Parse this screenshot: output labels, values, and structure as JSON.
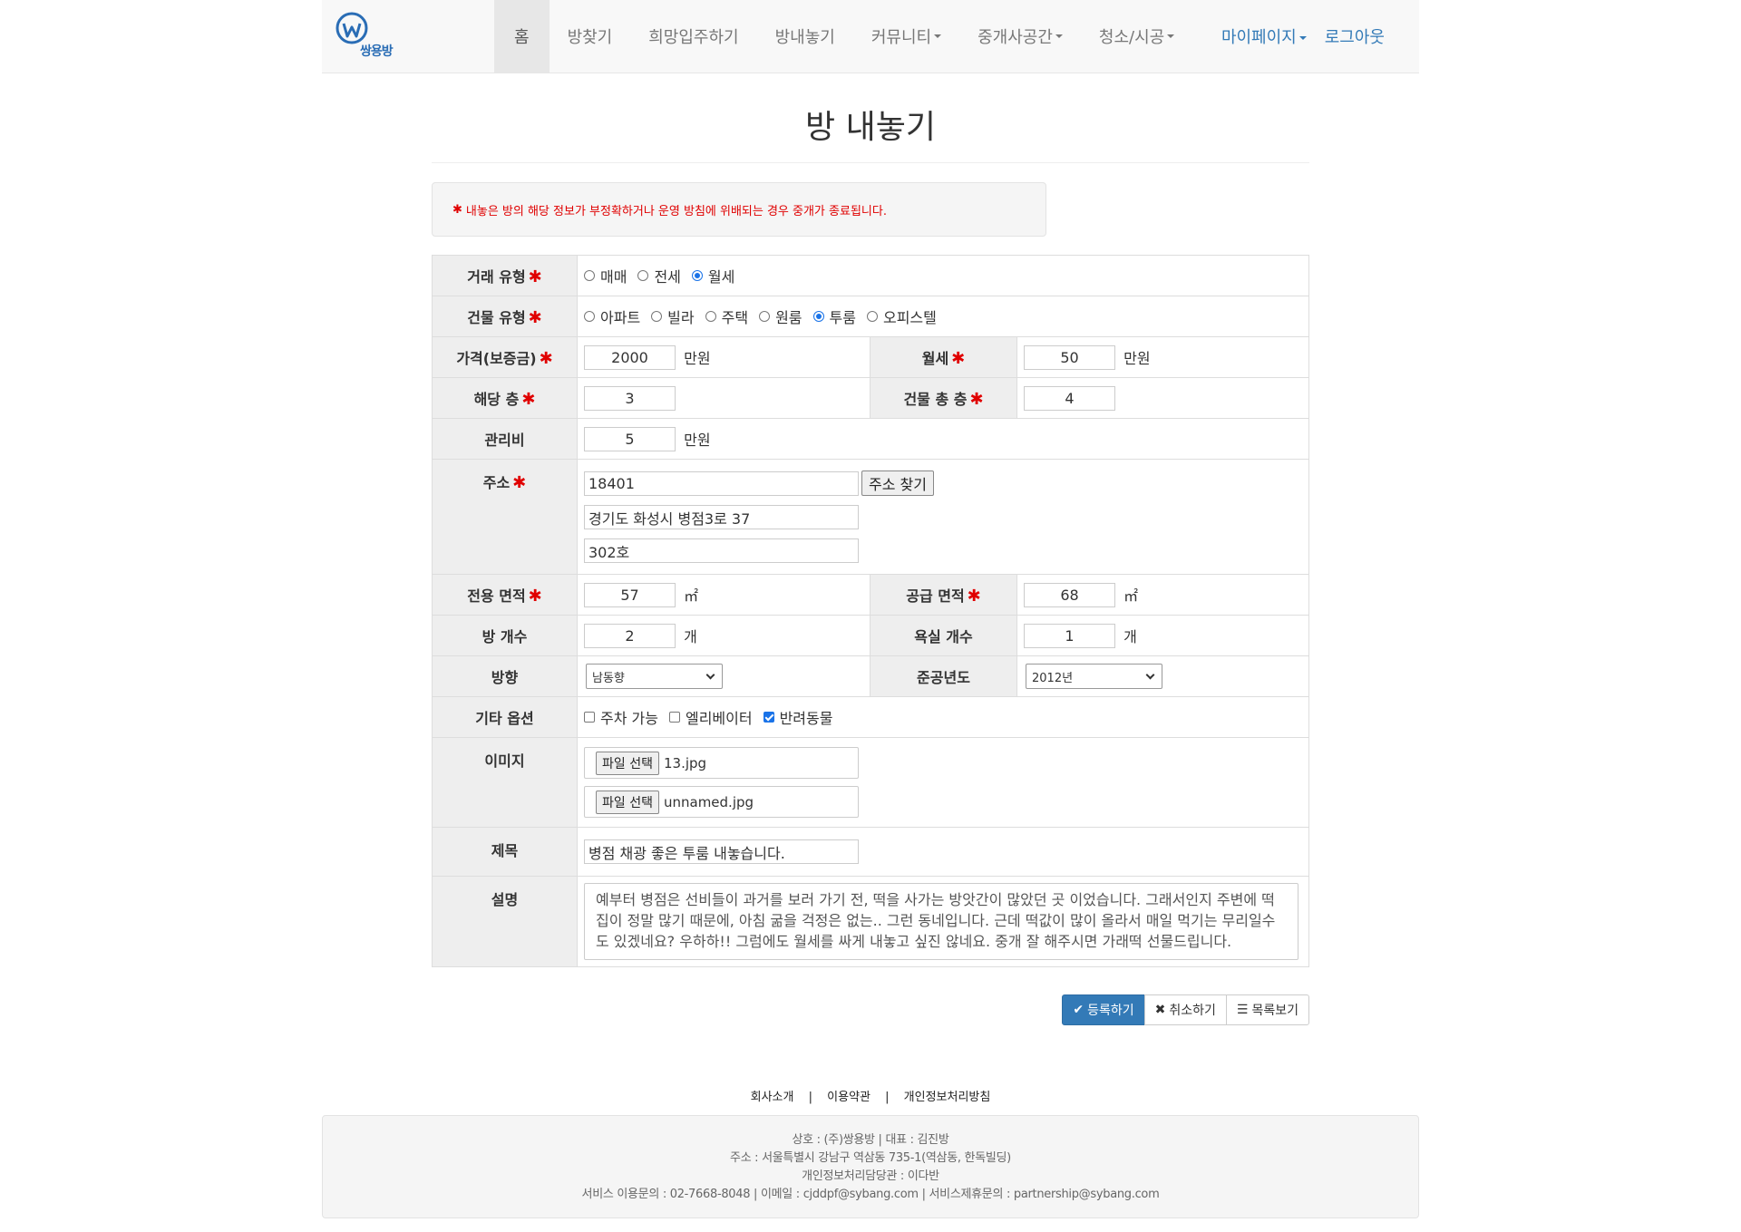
{
  "brand": {
    "name": "쌍용방"
  },
  "nav": {
    "items": [
      {
        "label": "홈"
      },
      {
        "label": "방찾기"
      },
      {
        "label": "희망입주하기"
      },
      {
        "label": "방내놓기"
      },
      {
        "label": "커뮤니티"
      },
      {
        "label": "중개사공간"
      },
      {
        "label": "청소/시공"
      }
    ],
    "right": [
      {
        "label": "마이페이지"
      },
      {
        "label": "로그아웃"
      }
    ]
  },
  "page": {
    "title": "방 내놓기",
    "notice": "내놓은 방의 해당 정보가 부정확하거나 운영 방침에 위배되는 경우 중개가 종료됩니다."
  },
  "form": {
    "trade_type": {
      "label": "거래 유형",
      "options": [
        "매매",
        "전세",
        "월세"
      ],
      "selected": "월세"
    },
    "building_type": {
      "label": "건물 유형",
      "options": [
        "아파트",
        "빌라",
        "주택",
        "원룸",
        "투룸",
        "오피스텔"
      ],
      "selected": "투룸"
    },
    "deposit": {
      "label": "가격(보증금)",
      "value": "2000",
      "unit": "만원"
    },
    "monthly": {
      "label": "월세",
      "value": "50",
      "unit": "만원"
    },
    "floor": {
      "label": "해당 층",
      "value": "3"
    },
    "total_floor": {
      "label": "건물 총 층",
      "value": "4"
    },
    "maintenance": {
      "label": "관리비",
      "value": "5",
      "unit": "만원"
    },
    "address": {
      "label": "주소",
      "zipcode": "18401",
      "find_button": "주소 찾기",
      "road": "경기도 화성시 병점3로 37",
      "detail": "302호"
    },
    "exclusive_area": {
      "label": "전용 면적",
      "value": "57",
      "unit": "㎡"
    },
    "supply_area": {
      "label": "공급 면적",
      "value": "68",
      "unit": "㎡"
    },
    "rooms": {
      "label": "방 개수",
      "value": "2",
      "unit": "개"
    },
    "bathrooms": {
      "label": "욕실 개수",
      "value": "1",
      "unit": "개"
    },
    "direction": {
      "label": "방향",
      "value": "남동향"
    },
    "built_year": {
      "label": "준공년도",
      "value": "2012년"
    },
    "options": {
      "label": "기타 옵션",
      "items": [
        {
          "label": "주차 가능",
          "checked": false
        },
        {
          "label": "엘리베이터",
          "checked": false
        },
        {
          "label": "반려동물",
          "checked": true
        }
      ]
    },
    "images": {
      "label": "이미지",
      "button": "파일 선택",
      "files": [
        "13.jpg",
        "unnamed.jpg"
      ]
    },
    "subject": {
      "label": "제목",
      "value": "병점 채광 좋은 투룸 내놓습니다."
    },
    "description": {
      "label": "설명",
      "value": "예부터 병점은 선비들이 과거를 보러 가기 전, 떡을 사가는 방앗간이 많았던 곳 이었습니다. 그래서인지 주변에 떡집이 정말 많기 때문에, 아침 굶을 걱정은 없는.. 그런 동네입니다. 근데 떡값이 많이 올라서 매일 먹기는 무리일수도 있겠네요? 우하하!! 그럼에도 월세를 싸게 내놓고 싶진 않네요. 중개 잘 해주시면 가래떡 선물드립니다."
    }
  },
  "actions": {
    "register": "등록하기",
    "cancel": "취소하기",
    "list": "목록보기"
  },
  "footer": {
    "links": [
      "회사소개",
      "이용약관",
      "개인정보처리방침"
    ],
    "lines": [
      "상호 : (주)쌍용방 | 대표 : 김진방",
      "주소 : 서울특별시 강남구 역삼동 735-1(역삼동, 한독빌딩)",
      "개인정보처리담당관 : 이다반",
      "서비스 이용문의 : 02-7668-8048 | 이메일 : cjddpf@sybang.com | 서비스제휴문의 : partnership@sybang.com"
    ]
  },
  "colors": {
    "primary": "#337ab7",
    "required": "#e00000",
    "logo": "#2a6db5"
  }
}
